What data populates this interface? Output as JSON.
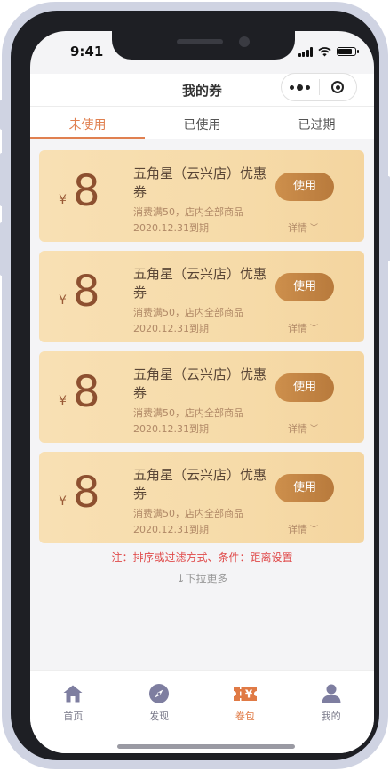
{
  "status_bar": {
    "time": "9:41",
    "signal_icon": "signal-icon",
    "wifi_icon": "wifi-icon",
    "battery_icon": "battery-icon"
  },
  "nav": {
    "title": "我的券",
    "more_icon": "more-dots-icon",
    "close_icon": "close-circle-icon"
  },
  "tabs": [
    {
      "label": "未使用",
      "active": true
    },
    {
      "label": "已使用",
      "active": false
    },
    {
      "label": "已过期",
      "active": false
    }
  ],
  "coupons": [
    {
      "currency": "¥",
      "amount": "8",
      "name": "五角星（云兴店）优惠券",
      "condition": "消费满50，店内全部商品",
      "expire": "2020.12.31到期",
      "action": "使用",
      "details": "详情"
    },
    {
      "currency": "¥",
      "amount": "8",
      "name": "五角星（云兴店）优惠券",
      "condition": "消费满50，店内全部商品",
      "expire": "2020.12.31到期",
      "action": "使用",
      "details": "详情"
    },
    {
      "currency": "¥",
      "amount": "8",
      "name": "五角星（云兴店）优惠券",
      "condition": "消费满50，店内全部商品",
      "expire": "2020.12.31到期",
      "action": "使用",
      "details": "详情"
    },
    {
      "currency": "¥",
      "amount": "8",
      "name": "五角星（云兴店）优惠券",
      "condition": "消费满50，店内全部商品",
      "expire": "2020.12.31到期",
      "action": "使用",
      "details": "详情"
    }
  ],
  "note": "注：排序或过滤方式、条件：距离设置",
  "pull_more": "↓下拉更多",
  "tabbar": [
    {
      "label": "首页",
      "icon": "home-icon",
      "active": false
    },
    {
      "label": "发现",
      "icon": "compass-icon",
      "active": false
    },
    {
      "label": "卷包",
      "icon": "coupon-ticket-icon",
      "active": true
    },
    {
      "label": "我的",
      "icon": "user-icon",
      "active": false
    }
  ],
  "colors": {
    "accent": "#e08050",
    "coupon_bg": "#f6dba9",
    "amount_text": "#8d5030",
    "use_button": "#c0843f",
    "note_text": "#e04a4a",
    "tab_inactive": "#7a7a8a"
  }
}
